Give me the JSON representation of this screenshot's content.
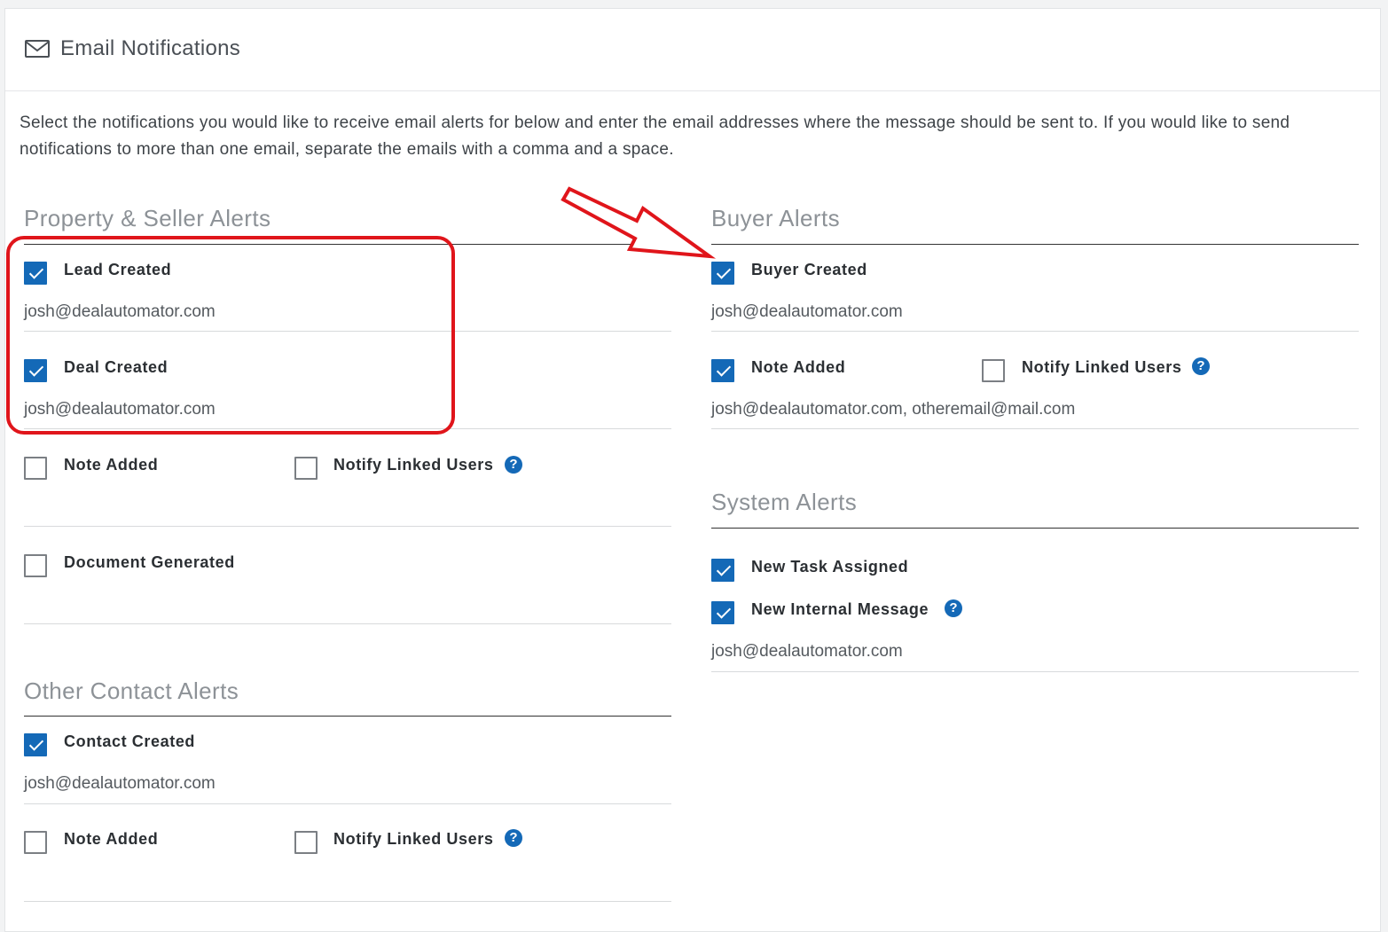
{
  "header": {
    "title": "Email Notifications",
    "icon": "envelope-icon"
  },
  "intro": "Select the notifications you would like to receive email alerts for below and enter the email addresses where the message should be sent to. If you would like to send notifications to more than one email, separate the emails with a comma and a space.",
  "property_seller": {
    "title": "Property & Seller Alerts",
    "lead_created": {
      "label": "Lead Created",
      "checked": true,
      "email": "josh@dealautomator.com"
    },
    "deal_created": {
      "label": "Deal Created",
      "checked": true,
      "email": "josh@dealautomator.com"
    },
    "note_added": {
      "label": "Note Added",
      "checked": false
    },
    "notify_linked": {
      "label": "Notify Linked Users",
      "checked": false
    },
    "document_generated": {
      "label": "Document Generated",
      "checked": false
    }
  },
  "other_contact": {
    "title": "Other Contact Alerts",
    "contact_created": {
      "label": "Contact Created",
      "checked": true,
      "email": "josh@dealautomator.com"
    },
    "note_added": {
      "label": "Note Added",
      "checked": false
    },
    "notify_linked": {
      "label": "Notify Linked Users",
      "checked": false
    }
  },
  "buyer": {
    "title": "Buyer Alerts",
    "buyer_created": {
      "label": "Buyer Created",
      "checked": true,
      "email": "josh@dealautomator.com"
    },
    "note_added": {
      "label": "Note Added",
      "checked": true,
      "email": "josh@dealautomator.com, otheremail@mail.com"
    },
    "notify_linked": {
      "label": "Notify Linked Users",
      "checked": false
    }
  },
  "system": {
    "title": "System Alerts",
    "new_task": {
      "label": "New Task Assigned",
      "checked": true
    },
    "new_message": {
      "label": "New Internal Message",
      "checked": true
    },
    "email": "josh@dealautomator.com"
  },
  "help_glyph": "?",
  "colors": {
    "accent": "#1469b7",
    "annotation": "#e0151b",
    "section_title": "#8d9297"
  }
}
